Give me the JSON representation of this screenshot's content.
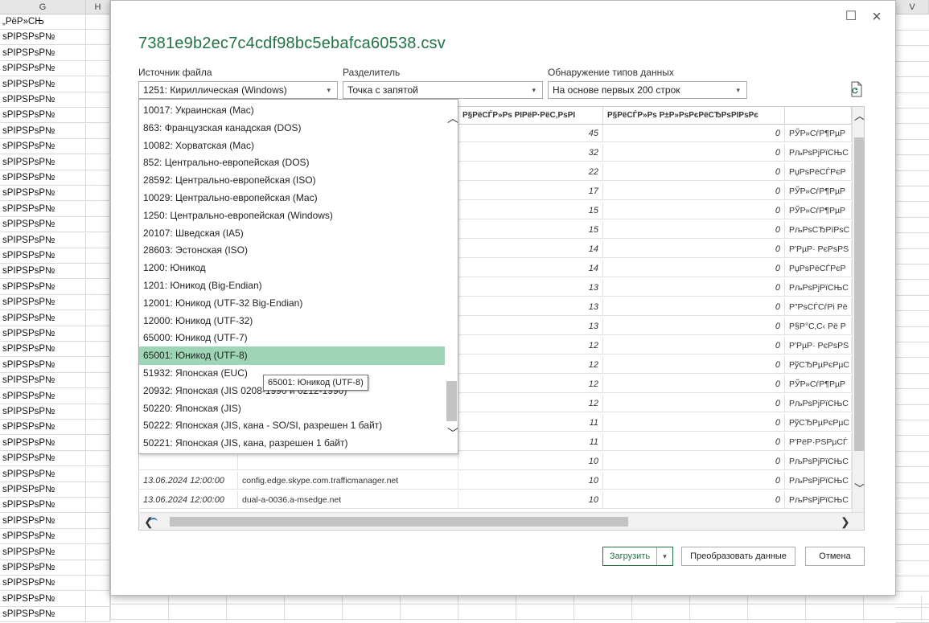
{
  "sheet": {
    "col_headers": [
      "G",
      "H",
      "V"
    ],
    "row_header_text": "„PëP»CЊ",
    "row_text": "sPIPSPsP№",
    "row_count": 39
  },
  "dialog": {
    "title": "7381e9b2ec7c4cdf98bc5ebafca60538.csv",
    "file_origin_label": "Источник файла",
    "file_origin_value": "1251: Кириллическая (Windows)",
    "delimiter_label": "Разделитель",
    "delimiter_value": "Точка с запятой",
    "type_detection_label": "Обнаружение типов данных",
    "type_detection_value": "На основе первых 200 строк",
    "load_button": "Загрузить",
    "transform_button": "Преобразовать данные",
    "cancel_button": "Отмена",
    "tooltip": "65001: Юникод (UTF-8)"
  },
  "encoding_list": [
    "10017: Украинская (Mac)",
    "863: Французская канадская (DOS)",
    "10082: Хорватская (Mac)",
    "852: Центрально-европейская (DOS)",
    "28592: Центрально-европейская (ISO)",
    "10029: Центрально-европейская (Mac)",
    "1250: Центрально-европейская (Windows)",
    "20107: Шведская (IA5)",
    "28603: Эстонская (ISO)",
    "1200: Юникод",
    "1201: Юникод (Big-Endian)",
    "12001: Юникод (UTF-32 Big-Endian)",
    "12000: Юникод (UTF-32)",
    "65000: Юникод (UTF-7)",
    "65001: Юникод (UTF-8)",
    "51932: Японская (EUC)",
    "20932: Японская (JIS 0208-1990 и 0212-1990)",
    "50220: Японская (JIS)",
    "50222: Японская (JIS, кана - SO/SI, разрешен 1 байт)",
    "50221: Японская (JIS, кана, разрешен 1 байт)"
  ],
  "selected_encoding_index": 14,
  "preview": {
    "headers": [
      "Р§РёСЃР»Рѕ РІРёР·РёС‚РѕРІ",
      "Р§РёСЃР»Рѕ Р±Р»РѕРєРёСЂРѕРІРѕРє",
      ""
    ],
    "rows": [
      {
        "date": "",
        "host": "",
        "visits": "45",
        "blocks": "0",
        "extra": "РЎР»СѓР¶РµР"
      },
      {
        "date": "",
        "host": "",
        "visits": "32",
        "blocks": "0",
        "extra": "РљРѕРјРїСЊС"
      },
      {
        "date": "",
        "host": "",
        "visits": "22",
        "blocks": "0",
        "extra": "РџРѕРёСЃРєР"
      },
      {
        "date": "",
        "host": "",
        "visits": "17",
        "blocks": "0",
        "extra": "РЎР»СѓР¶РµР"
      },
      {
        "date": "",
        "host": "",
        "visits": "15",
        "blocks": "0",
        "extra": "РЎР»СѓР¶РµР"
      },
      {
        "date": "",
        "host": "",
        "visits": "15",
        "blocks": "0",
        "extra": "РљРѕСЂРїРѕС"
      },
      {
        "date": "",
        "host": "",
        "visits": "14",
        "blocks": "0",
        "extra": "Р'РµР· РєРѕРЅ"
      },
      {
        "date": "",
        "host": "",
        "visits": "14",
        "blocks": "0",
        "extra": "РџРѕРёСЃРєР"
      },
      {
        "date": "",
        "host": "",
        "visits": "13",
        "blocks": "0",
        "extra": "РљРѕРјРїСЊС"
      },
      {
        "date": "",
        "host": "",
        "visits": "13",
        "blocks": "0",
        "extra": "Р”РѕСЃСѓРі Рё"
      },
      {
        "date": "",
        "host": "",
        "visits": "13",
        "blocks": "0",
        "extra": "Р§Р°С‚С‹ Рё Р"
      },
      {
        "date": "",
        "host": "",
        "visits": "12",
        "blocks": "0",
        "extra": "Р'РµР· РєРѕРЅ"
      },
      {
        "date": "",
        "host": "",
        "visits": "12",
        "blocks": "0",
        "extra": "РўСЂРµРєРµС"
      },
      {
        "date": "",
        "host": "",
        "visits": "12",
        "blocks": "0",
        "extra": "РЎР»СѓР¶РµР"
      },
      {
        "date": "",
        "host": "",
        "visits": "12",
        "blocks": "0",
        "extra": "РљРѕРјРїСЊС"
      },
      {
        "date": "",
        "host": "",
        "visits": "11",
        "blocks": "0",
        "extra": "РўСЂРµРєРµС"
      },
      {
        "date": "",
        "host": "",
        "visits": "11",
        "blocks": "0",
        "extra": "Р'РёР·РЅРµСЃ"
      },
      {
        "date": "",
        "host": "",
        "visits": "10",
        "blocks": "0",
        "extra": "РљРѕРјРїСЊС"
      },
      {
        "date": "13.06.2024 12:00:00",
        "host": "config.edge.skype.com.trafficmanager.net",
        "visits": "10",
        "blocks": "0",
        "extra": "РљРѕРјРїСЊС"
      },
      {
        "date": "13.06.2024 12:00:00",
        "host": "dual-a-0036.a-msedge.net",
        "visits": "10",
        "blocks": "0",
        "extra": "РљРѕРјРїСЊС"
      }
    ]
  },
  "icons": {
    "close": "×",
    "maximize": "☐",
    "caret": "▾",
    "scroll_up": "︿",
    "scroll_down": "﹀",
    "scroll_left": "❮",
    "scroll_right": "❯"
  }
}
